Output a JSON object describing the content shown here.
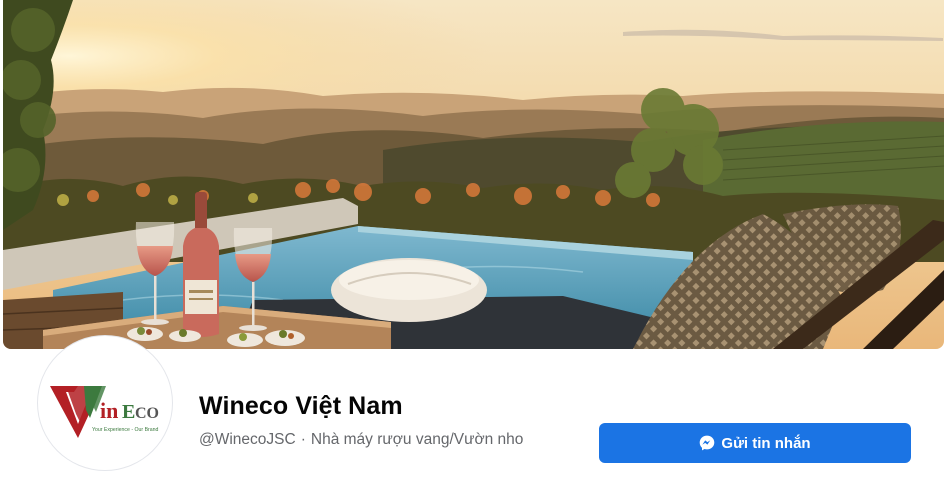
{
  "profile": {
    "page_name": "Wineco Việt Nam",
    "handle": "@WinecoJSC",
    "separator": "·",
    "category": "Nhà máy rượu vang/Vườn nho"
  },
  "actions": {
    "send_message_label": "Gửi tin nhắn"
  },
  "logo": {
    "brand": "WinEco",
    "tagline": "Your Experience - Our Brand",
    "colors": {
      "red": "#b32025",
      "green": "#3c7a3f",
      "gray": "#555555"
    }
  },
  "colors": {
    "accent": "#1b74e4",
    "text_primary": "#050505",
    "text_secondary": "#65676b"
  }
}
